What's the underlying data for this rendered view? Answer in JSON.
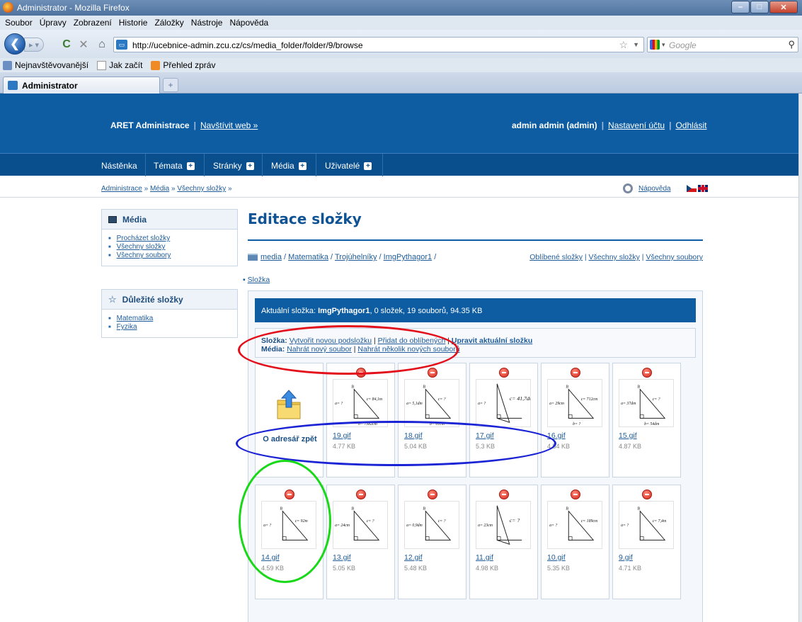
{
  "window": {
    "title": "Administrator - Mozilla Firefox",
    "controls": [
      "–",
      "□",
      "✕"
    ]
  },
  "menubar": [
    "Soubor",
    "Úpravy",
    "Zobrazení",
    "Historie",
    "Záložky",
    "Nástroje",
    "Nápověda"
  ],
  "navbar": {
    "url": "http://ucebnice-admin.zcu.cz/cs/media_folder/folder/9/browse",
    "search_placeholder": "Google"
  },
  "bookmarks": [
    "Nejnavštěvovanější",
    "Jak začít",
    "Přehled zpráv"
  ],
  "tabs": {
    "active": "Administrator",
    "new_tab": "+"
  },
  "header": {
    "brand": "ARET Administrace",
    "visit_link": "Navštívit web »",
    "user": "admin admin (admin)",
    "settings_link": "Nastavení účtu",
    "logout_link": "Odhlásit",
    "separator": "|"
  },
  "main_menu": [
    "Nástěnka",
    "Témata",
    "Stránky",
    "Média",
    "Uživatelé"
  ],
  "breadcrumb": {
    "items": [
      "Administrace",
      "Média",
      "Všechny složky"
    ],
    "sep": "»",
    "help": "Nápověda"
  },
  "sidebar": {
    "media_title": "Média",
    "media_links": [
      "Procházet složky",
      "Všechny složky",
      "Všechny soubory"
    ],
    "important_title": "Důležité složky",
    "important_links": [
      "Matematika",
      "Fyzika"
    ]
  },
  "main": {
    "title": "Editace složky",
    "path": [
      "media",
      "Matematika",
      "Trojúhelníky",
      "ImgPythagor1"
    ],
    "path_sep": " / ",
    "quick_links": [
      "Oblíbené složky",
      "Všechny složky",
      "Všechny soubory"
    ],
    "folder_tab": "Složka",
    "info_prefix": "Aktuální složka:",
    "info_folder": "ImgPythagor1",
    "info_rest": ", 0 složek, 19 souborů, 94.35 KB",
    "folder_actions_label": "Složka:",
    "folder_actions": [
      "Vytvořit novou podsložku",
      "Přidat do oblíbených",
      "Upravit aktuální složku"
    ],
    "media_actions_label": "Média:",
    "media_actions": [
      "Nahrát nový soubor",
      "Nahrát několik nových souborů"
    ],
    "back_label": "O adresář zpět"
  },
  "files": [
    {
      "name": "19.gif",
      "size": "4.77 KB",
      "labels": [
        "B",
        "a= ?",
        "c= 84,1m",
        "b= 7382cm"
      ]
    },
    {
      "name": "18.gif",
      "size": "5.04 KB",
      "labels": [
        "B",
        "a= 5,1dm",
        "c= ?",
        "b= 61cm"
      ]
    },
    {
      "name": "17.gif",
      "size": "5.3 KB",
      "labels": [
        "B",
        "a= ?",
        "c= 41,7dm",
        ""
      ]
    },
    {
      "name": "16.gif",
      "size": "4.54 KB",
      "labels": [
        "B",
        "a= 29cm",
        "c= 712cm",
        "b= ?"
      ]
    },
    {
      "name": "15.gif",
      "size": "4.87 KB",
      "labels": [
        "B",
        "a= 37dm",
        "c= ?",
        "b= 54dm"
      ]
    },
    {
      "name": "14.gif",
      "size": "4.59 KB",
      "labels": [
        "B",
        "a= ?",
        "c= 92m",
        ""
      ]
    },
    {
      "name": "13.gif",
      "size": "5.05 KB",
      "labels": [
        "B",
        "a= 24cm",
        "c= ?",
        ""
      ]
    },
    {
      "name": "12.gif",
      "size": "5.48 KB",
      "labels": [
        "B",
        "a= 0,9dm",
        "c= ?",
        ""
      ]
    },
    {
      "name": "11.gif",
      "size": "4.98 KB",
      "labels": [
        "B",
        "a= 23cm",
        "c= ?",
        ""
      ]
    },
    {
      "name": "10.gif",
      "size": "5.35 KB",
      "labels": [
        "B",
        "a= ?",
        "c= 189cm",
        ""
      ]
    },
    {
      "name": "9.gif",
      "size": "4.71 KB",
      "labels": [
        "B",
        "a= ?",
        "c= 7,4m",
        ""
      ]
    }
  ],
  "colors": {
    "header_blue": "#0e5da3",
    "link_blue": "#1f5c99",
    "annotation_red": "#e3101b",
    "annotation_blue": "#1b24d4",
    "annotation_green": "#18d818"
  }
}
